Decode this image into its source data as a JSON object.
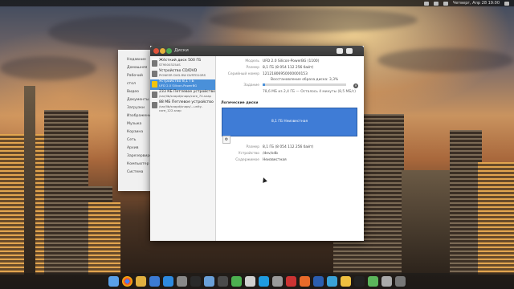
{
  "window": {
    "title": "Диски"
  },
  "background_sidebar": {
    "items": [
      "Недавние",
      "Домашняя",
      "Рабочий стол",
      "Видео",
      "Документы",
      "Загрузки",
      "Изображения",
      "Музыка",
      "Корзина",
      "Сеть",
      "Архив",
      "Зарезервировано",
      "Компьютер",
      "Система"
    ]
  },
  "drives": [
    {
      "name": "Жёсткий диск 500 ГБ",
      "sub": "ST9500325AS"
    },
    {
      "name": "Устройство CD/DVD",
      "sub": "PIONEER DVD-RW DVRTD10RS"
    },
    {
      "name": "Устройство 8,1 ГБ",
      "sub": "UFD 2.0 Silicon-PowerBG"
    },
    {
      "name": "233 КБ Петлевое устройство",
      "sub": "/var/lib/snapd/snaps/core_74.snap"
    },
    {
      "name": "88 МБ Петлевое устройство",
      "sub": "/var/lib/snapd/snaps/...unity-core_122.snap"
    }
  ],
  "details": {
    "model_label": "Модель",
    "model": "UFD 2.0 Silicon-PowerBG (1100)",
    "size_label": "Размер",
    "size": "8,1 ГБ (8 054 112 256 байт)",
    "serial_label": "Серийный номер",
    "serial": "12121806950000000153",
    "task_label": "Задание",
    "task": "Восстановление образа диска: 3,3%",
    "progress": 0.033,
    "task_sub": "78,6 МБ из 2,4 ГБ — Осталось 4 минуты (8,5 МБ/с)"
  },
  "volumes": {
    "section_label": "Логические диски",
    "volume_label": "8,1 ГБ Неизвестная",
    "gear_icon": "⚙",
    "size_label": "Размер",
    "size": "8,1 ГБ (8 054 112 256 байт)",
    "device_label": "Устройство",
    "device": "/dev/sdb",
    "contents_label": "Содержимое",
    "contents": "Неизвестная"
  },
  "topbar": {
    "clock": "Четверг, Апр 28 19:00"
  }
}
